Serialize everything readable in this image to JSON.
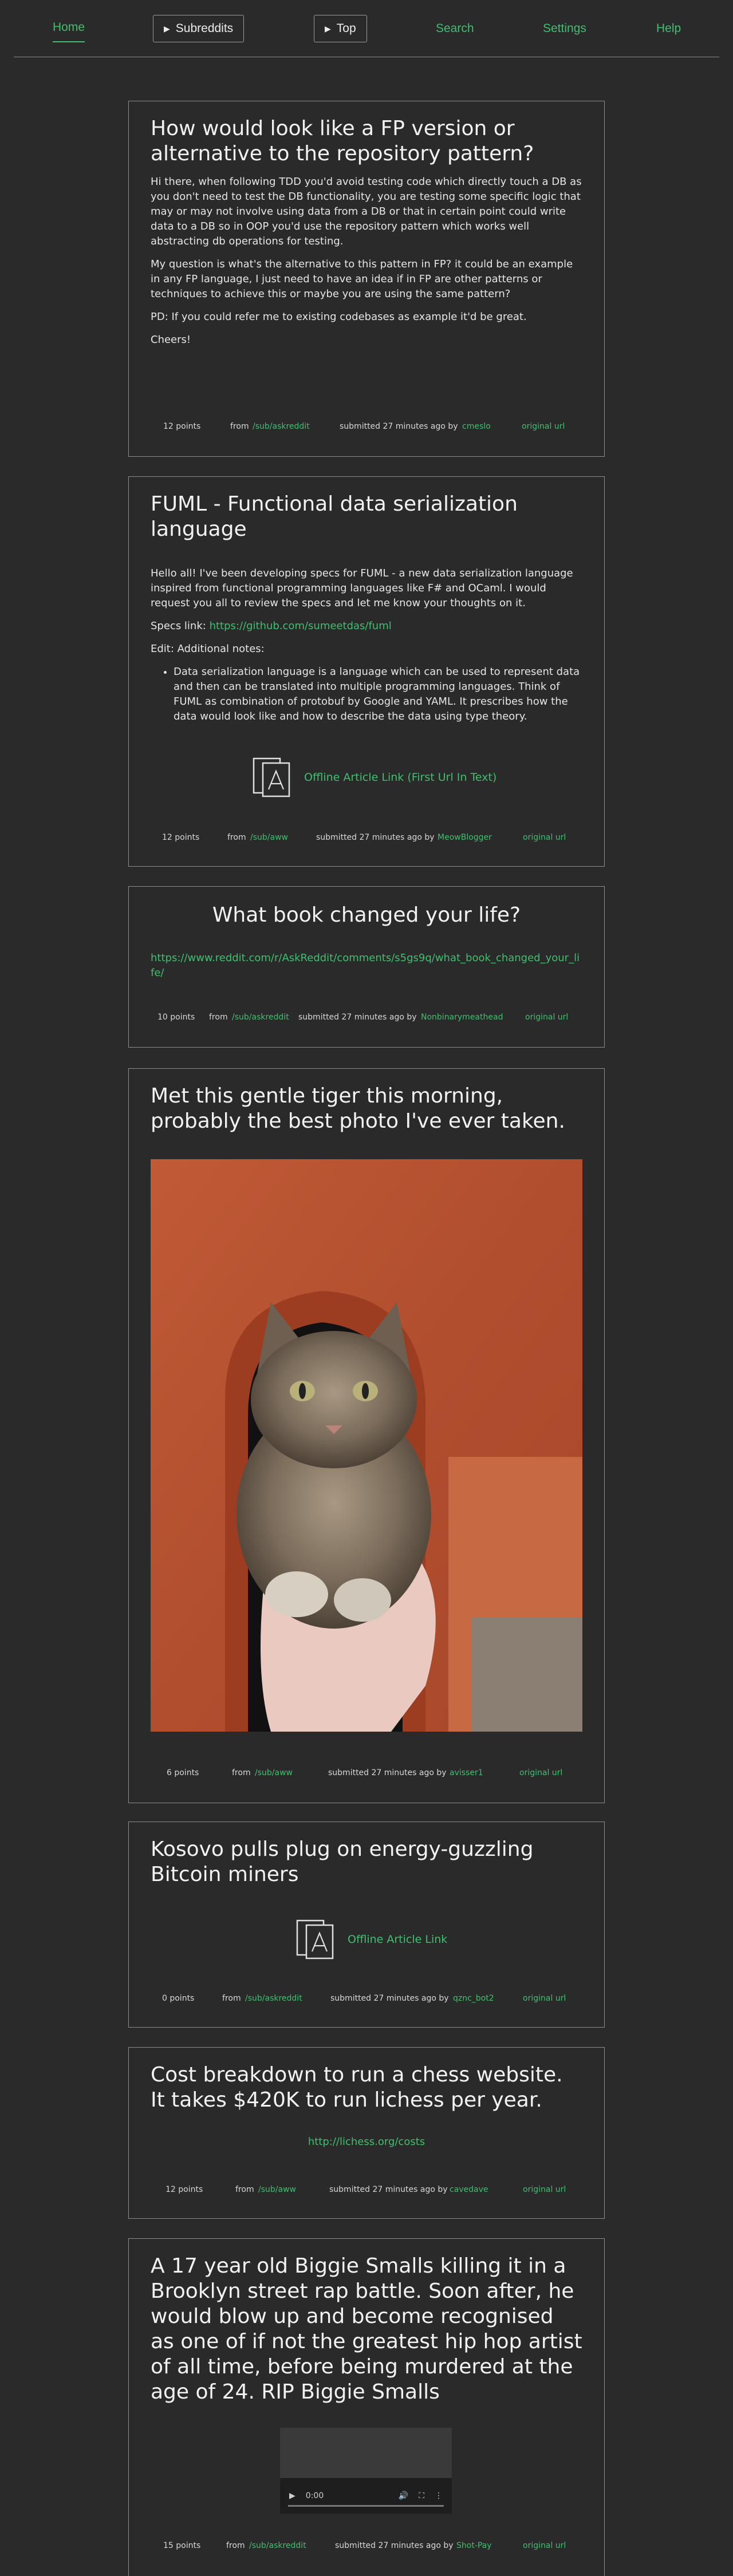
{
  "nav": {
    "home": "Home",
    "subreddits": "Subreddits",
    "top": "Top",
    "search": "Search",
    "settings": "Settings",
    "help": "Help"
  },
  "posts": [
    {
      "title": "How would look like a FP version or alternative to the repository pattern?",
      "paragraphs": [
        "Hi there, when following TDD you'd avoid testing code which directly touch a DB as you don't need to test the DB functionality, you are testing some specific logic that may or may not involve using data from a DB or that in certain point could write data to a DB so in OOP you'd use the repository pattern which works well abstracting db operations for testing.",
        "My question is what's the alternative to this pattern in FP? it could be an example in any FP language, I just need to have an idea if in FP are other patterns or techniques to achieve this or maybe you are using the same pattern?",
        "PD: If you could refer me to existing codebases as example it'd be great.",
        "Cheers!"
      ],
      "points": "12 points",
      "from": "from",
      "sub": "/sub/askreddit",
      "submitted": "submitted 27 minutes ago by",
      "user": "cmeslo",
      "original": "original url"
    },
    {
      "title": "FUML - Functional data serialization language",
      "p1": "Hello all! I've been developing specs for FUML - a new data serialization language inspired from functional programming languages like F# and OCaml. I would request you all to review the specs and let me know your thoughts on it.",
      "specs_label": "Specs link:",
      "specs_link": "https://github.com/sumeetdas/fuml",
      "edit": "Edit: Additional notes:",
      "bullet": "Data serialization language is a language which can be used to represent data and then can be translated into multiple programming languages. Think of FUML as combination of protobuf by Google and YAML. It prescribes how the data would look like and how to describe the data using type theory.",
      "pdf_link": "Offline Article Link (First Url In Text)",
      "points": "12 points",
      "from": "from",
      "sub": "/sub/aww",
      "submitted": "submitted 27 minutes ago by",
      "user": "MeowBlogger",
      "original": "original url"
    },
    {
      "title": "What book changed your life?",
      "link": "https://www.reddit.com/r/AskReddit/comments/s5gs9q/what_book_changed_your_life/",
      "points": "10 points",
      "from": "from",
      "sub": "/sub/askreddit",
      "submitted": "submitted 27 minutes ago by",
      "user": "Nonbinarymeathead",
      "original": "original url"
    },
    {
      "title": "Met this gentle tiger this morning, probably the best photo I've ever taken.",
      "points": "6 points",
      "from": "from",
      "sub": "/sub/aww",
      "submitted": "submitted 27 minutes ago by",
      "user": "avisser1",
      "original": "original url"
    },
    {
      "title": "Kosovo pulls plug on energy-guzzling Bitcoin miners",
      "pdf_link": "Offline Article Link",
      "points": "0 points",
      "from": "from",
      "sub": "/sub/askreddit",
      "submitted": "submitted 27 minutes ago by",
      "user": "qznc_bot2",
      "original": "original url"
    },
    {
      "title": "Cost breakdown to run a chess website. It takes $420K to run lichess per year.",
      "link": "http://lichess.org/costs",
      "points": "12 points",
      "from": "from",
      "sub": "/sub/aww",
      "submitted": "submitted 27 minutes ago by",
      "user": "cavedave",
      "original": "original url"
    },
    {
      "title": "A 17 year old Biggie Smalls killing it in a Brooklyn street rap battle. Soon after, he would blow up and become recognised as one of if not the greatest hip hop artist of all time, before being murdered at the age of 24. RIP Biggie Smalls",
      "video_time": "0:00",
      "points": "15 points",
      "from": "from",
      "sub": "/sub/askreddit",
      "submitted": "submitted 27 minutes ago by",
      "user": "Shot-Pay",
      "original": "original url"
    }
  ],
  "colors": {
    "background": "#2b2a2b",
    "accent": "#3fbf6f",
    "border": "#8c8c8c",
    "text": "#ececec"
  }
}
